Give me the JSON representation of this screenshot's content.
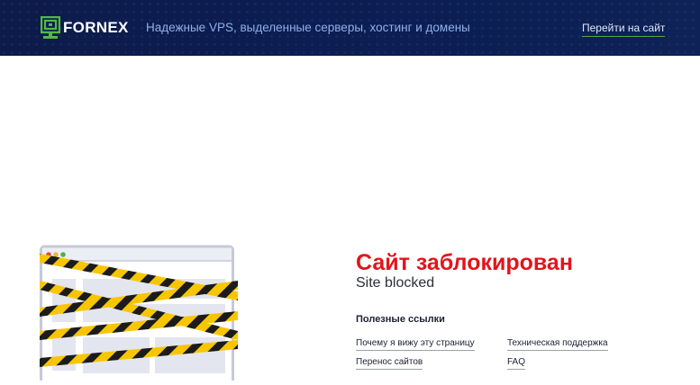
{
  "header": {
    "logo_text": "FORNEX",
    "tagline": "Надежные VPS, выделенные серверы, хостинг и домены",
    "goto_link": "Перейти на сайт"
  },
  "main": {
    "title": "Сайт заблокирован",
    "subtitle": "Site blocked",
    "useful_links_title": "Полезные ссылки",
    "links": [
      "Почему я вижу эту страницу",
      "Техническая поддержка",
      "Перенос сайтов",
      "FAQ"
    ]
  },
  "colors": {
    "header_bg": "#0d1b4a",
    "logo_green": "#52b946",
    "title_red": "#e2141b",
    "tape_yellow": "#f7c600"
  },
  "icons": [
    "fornex-logo-icon",
    "blocked-site-illustration",
    "caution-tape"
  ]
}
